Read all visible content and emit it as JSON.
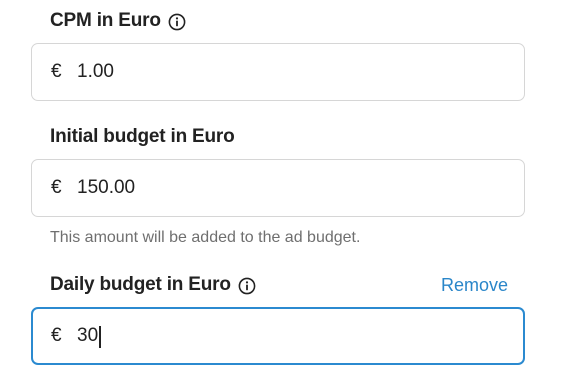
{
  "cpm": {
    "label": "CPM in Euro",
    "info_icon": "info-circle-icon",
    "currency_symbol": "€",
    "value": "1.00"
  },
  "initial_budget": {
    "label": "Initial budget in Euro",
    "currency_symbol": "€",
    "value": "150.00",
    "helper_text": "This amount will be added to the ad budget."
  },
  "daily_budget": {
    "label": "Daily budget in Euro",
    "info_icon": "info-circle-icon",
    "remove_label": "Remove",
    "currency_symbol": "€",
    "value": "30"
  },
  "colors": {
    "focus_border": "#2b8ad0",
    "link": "#2a86c9",
    "helper_text": "#6f6f6f",
    "field_border": "#d6d6d6"
  }
}
